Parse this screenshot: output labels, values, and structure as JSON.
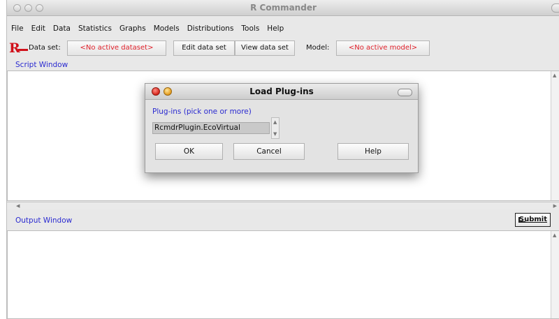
{
  "window": {
    "title": "R Commander"
  },
  "menu": {
    "items": [
      "File",
      "Edit",
      "Data",
      "Statistics",
      "Graphs",
      "Models",
      "Distributions",
      "Tools",
      "Help"
    ]
  },
  "toolbar": {
    "dataset_label": "Data set:",
    "dataset_value": "<No active dataset>",
    "edit_dataset": "Edit data set",
    "view_dataset": "View data set",
    "model_label": "Model:",
    "model_value": "<No active model>"
  },
  "script_window": {
    "label": "Script Window"
  },
  "output_window": {
    "label": "Output Window"
  },
  "submit": {
    "label": "Submit"
  },
  "dialog": {
    "title": "Load Plug-ins",
    "prompt": "Plug-ins (pick one or more)",
    "list_items": [
      "RcmdrPlugin.EcoVirtual"
    ],
    "ok": "OK",
    "cancel": "Cancel",
    "help": "Help"
  },
  "colors": {
    "label_blue": "#2a2ad0",
    "value_red": "#e0202a",
    "r_logo": "#d0101a"
  },
  "icons": [
    "r-logo-icon",
    "close-icon",
    "minimize-icon",
    "scroll-arrow-up-icon",
    "scroll-arrow-down-icon",
    "submit-return-icon"
  ]
}
